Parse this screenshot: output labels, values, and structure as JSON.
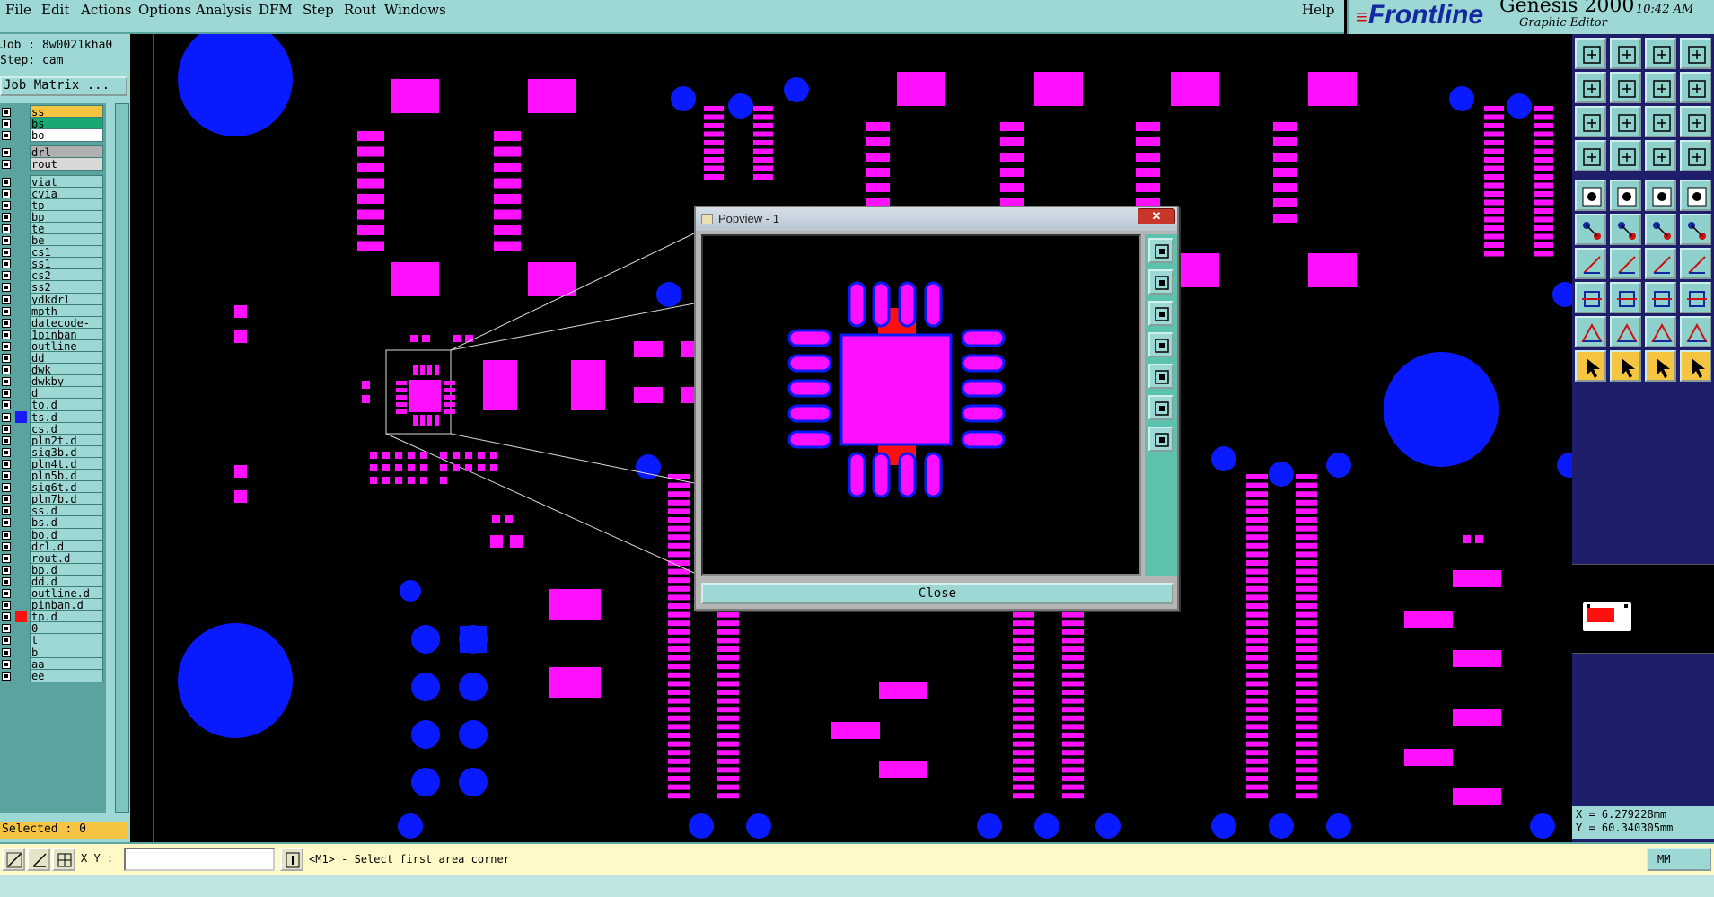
{
  "menu": {
    "items": [
      "File",
      "Edit",
      "Actions",
      "Options",
      "Analysis",
      "DFM",
      "Step",
      "Rout",
      "Windows"
    ],
    "help": "Help"
  },
  "brand": {
    "logo": "Frontline",
    "product": "Genesis 2000",
    "module": "Graphic Editor",
    "time": "10:42 AM"
  },
  "job": {
    "job_line": "Job : 8w0021kha0",
    "step_line": "Step: cam",
    "matrix_button": "Job Matrix ..."
  },
  "layers": [
    {
      "name": "ss",
      "bg": "#f5c542"
    },
    {
      "name": "bs",
      "bg": "#18a874"
    },
    {
      "name": "bo",
      "bg": "#ffffff"
    },
    {
      "name": "drl",
      "bg": "#b0b0b0",
      "gap": true
    },
    {
      "name": "rout",
      "bg": "#d8d8d8"
    },
    {
      "name": "viat",
      "gap": true
    },
    {
      "name": "cvia"
    },
    {
      "name": "tp"
    },
    {
      "name": "bp"
    },
    {
      "name": "te"
    },
    {
      "name": "be"
    },
    {
      "name": "cs1"
    },
    {
      "name": "ss1"
    },
    {
      "name": "cs2"
    },
    {
      "name": "ss2"
    },
    {
      "name": "ydkdrl"
    },
    {
      "name": "mpth"
    },
    {
      "name": "datecode-to"
    },
    {
      "name": "1pinban"
    },
    {
      "name": "outline"
    },
    {
      "name": "dd"
    },
    {
      "name": "dwk"
    },
    {
      "name": "dwkby"
    },
    {
      "name": "d"
    },
    {
      "name": "to.d"
    },
    {
      "name": "ts.d",
      "swatch": "#1a1aff"
    },
    {
      "name": "cs.d"
    },
    {
      "name": "pln2t.d"
    },
    {
      "name": "sig3b.d"
    },
    {
      "name": "pln4t.d"
    },
    {
      "name": "pln5b.d"
    },
    {
      "name": "sig6t.d"
    },
    {
      "name": "pln7b.d"
    },
    {
      "name": "ss.d"
    },
    {
      "name": "bs.d"
    },
    {
      "name": "bo.d"
    },
    {
      "name": "drl.d"
    },
    {
      "name": "rout.d"
    },
    {
      "name": "bp.d"
    },
    {
      "name": "dd.d"
    },
    {
      "name": "outline.d"
    },
    {
      "name": "pinban.d"
    },
    {
      "name": "tp.d",
      "swatch": "#ff1010"
    },
    {
      "name": "0"
    },
    {
      "name": "t"
    },
    {
      "name": "b"
    },
    {
      "name": "aa"
    },
    {
      "name": "ee"
    }
  ],
  "selected": "Selected : 0",
  "popview": {
    "title": "Popview - 1",
    "close_x": "✕",
    "close_button": "Close"
  },
  "coords": {
    "x": "X =  6.279228mm",
    "y": "Y = 60.340305mm"
  },
  "statusbar": {
    "xy_label": "X Y :",
    "xy_value": "",
    "message": "<M1> - Select first area corner",
    "units": "MM"
  },
  "colors": {
    "pad": "#ff10ff",
    "via": "#0a1aff",
    "highlight": "#ff1010",
    "panel": "#9ed8d4"
  },
  "icons": {
    "toolbar_rows": [
      [
        "open-job-icon",
        "save-icon",
        "home-icon",
        "layers-icon"
      ],
      [
        "zoom-prev-icon",
        "zoom-next-icon",
        "zoom-fit-icon",
        "snap-icon"
      ],
      [
        "zoom-area-icon",
        "pan-icon",
        "scale-1-2-icon",
        "help-icon"
      ],
      [
        "measure-icon",
        "grid-icon",
        "dfm-icon",
        "netlist-icon"
      ],
      [
        "select-pad-icon",
        "select-line-icon",
        "ruler-icon",
        "select-circle-icon"
      ],
      [
        "connect-icon",
        "cross-icon",
        "route-icon",
        "rotate-icon"
      ],
      [
        "line-tool-icon",
        "slash-icon",
        "arc-icon",
        "mirror-icon"
      ],
      [
        "feature-icon",
        "dash-icon",
        "bounds-icon",
        "component-icon"
      ],
      [
        "triangle-icon",
        "delta-icon",
        "trapezoid-icon",
        "wave-icon"
      ],
      [
        "pointer-icon",
        "pointer-select-icon",
        "pointer-target-icon",
        "pointer-route-icon"
      ]
    ],
    "popview_tools": [
      "pv-zoom-in-icon",
      "pv-zoom-out-icon",
      "pv-fit-icon",
      "pv-prev-icon",
      "pv-next-icon",
      "pv-expand-icon",
      "pv-pan-icon"
    ]
  }
}
